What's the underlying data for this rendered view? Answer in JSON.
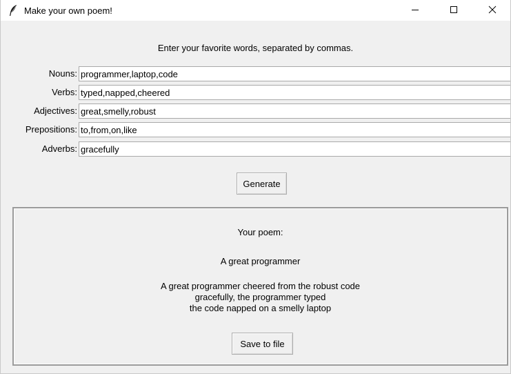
{
  "window": {
    "title": "Make your own poem!",
    "app_icon": "feather-icon",
    "controls": {
      "minimize_icon": "minimize-icon",
      "maximize_icon": "maximize-icon",
      "close_icon": "close-icon"
    }
  },
  "form": {
    "instructions": "Enter your favorite words, separated by commas.",
    "fields": [
      {
        "label": "Nouns:",
        "value": "programmer,laptop,code"
      },
      {
        "label": "Verbs:",
        "value": "typed,napped,cheered"
      },
      {
        "label": "Adjectives:",
        "value": "great,smelly,robust"
      },
      {
        "label": "Prepositions:",
        "value": "to,from,on,like"
      },
      {
        "label": "Adverbs:",
        "value": "gracefully"
      }
    ],
    "generate_label": "Generate"
  },
  "poem": {
    "heading": "Your poem:",
    "title": "A great programmer",
    "lines": [
      "A great programmer cheered from the robust code",
      "gracefully, the programmer typed",
      "the code napped on a smelly laptop"
    ],
    "save_label": "Save to file"
  }
}
